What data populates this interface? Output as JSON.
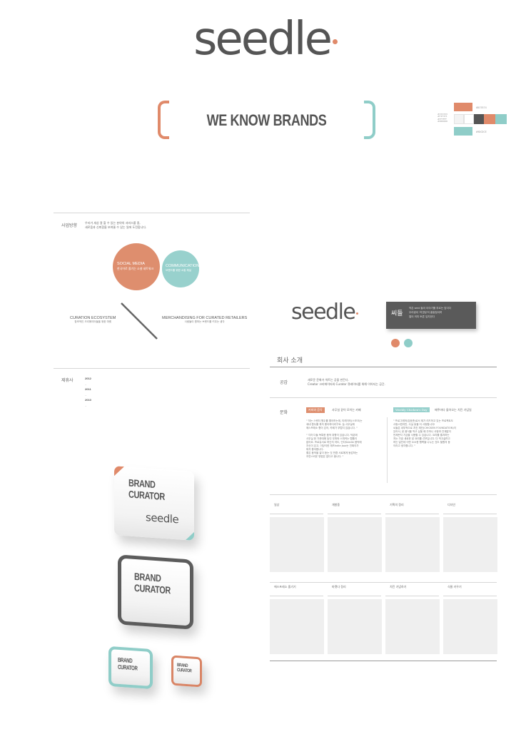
{
  "logo": {
    "text": "seedle"
  },
  "hero": {
    "tagline": "WE KNOW BRANDS"
  },
  "palette": {
    "colors": [
      "#e08a6a",
      "#f3f3f3",
      "#555555",
      "#8fcdc8"
    ],
    "hex_top": "#DC9374",
    "hex_left_1": "#333333",
    "hex_left_2": "#F3F3F3",
    "hex_left_3": "#FFFFFF",
    "hex_left_4": "#888888",
    "hex_bottom": "#9DCDCE"
  },
  "left_panel": {
    "direction_heading": "사업방향",
    "direction_text_1": "우리가 세상 잘 할 수 있는 분야의 서비스를 중,",
    "direction_text_2": "새로움과 신뢰함을 보여줄 수 있는 일에 도전합니다.",
    "social_title": "SOCIAL MEDIA",
    "social_sub": "한국어로 즐기는 소셜 네트워크",
    "comm_title": "COMMUNICATION",
    "comm_sub": "브랜드를 위한 소통 채널",
    "curation_title": "CURATION ECOSYSTEM",
    "curation_sub": "창조적인 크리에이터들을 위한 마켓",
    "merch_title": "MERCHANDISING FOR CURATED RETAILERS",
    "merch_sub": "사람들이 원하는 브랜드를 키우는 생각",
    "partners_heading": "제휴사",
    "years": [
      "2012",
      "2011",
      "2010"
    ]
  },
  "right_panel": {
    "logo": "seedle",
    "card_title": "씨들",
    "card_text_1": "작은 seed 들이 이야기를 부르는 앞이다",
    "card_text_2": "우리랑이 '커넷팅'의 출발점이며",
    "card_text_3": "열어 의미 토론 잎지한다",
    "section_title": "회사 소개",
    "empathy_label": "공감",
    "empathy_text_1": "새로운 문화가 싹트는 공을 만든다.",
    "empathy_text_2": "Creator 크리에이터와 Curator 큐레이터를 위해 이어지는 공간.",
    "culture_label": "문화",
    "culture_tag_1": "커피와 음악",
    "culture_tag_1_text": "사무실 같이 모이는 카페",
    "culture_tag_2": "Weekly Chicken's Day",
    "culture_tag_2_text": "매주마다 돌아오는 치킨 기념일",
    "culture_col1": [
      "\" 저는 스탠더 원두를 좋아하는데, 티레이터(스모크)는",
      "세내 원두를 특히 좋아하더라구요. 늘 사무실에",
      "에스프레소 향이 있어, 카페가 부럽지 않습니다. \"",
      "",
      "\" 각자 다들 독특한 음악 취향이 있습니다. 덕분에",
      "사무실 한 가운데에 놓인 우퍼와 스피커는 랩툽이",
      "없어요. 프로듀서로 하는지 저도, 인디Seedle 음악에",
      "자신이 있고, 이당이한 재즈Indie Jazz는 진짜이가",
      "특히 좋아합니다.",
      "좋은 음악을 같이 듣는 것 만큼 서로에게 동감하는",
      "자연스러운 방법은 없다고 봅니다. \""
    ],
    "culture_col2": [
      "\" 프로그래머(강호준)로서 제가 리드하고 있는 프로젝트도",
      "사랑스럽지만, 사실 닭을 더 사랑합니다!",
      "씨들은 내부적으로 치킨 재단(CHICKEN FOUNDATION)이",
      "있어서, 닭 음식을 먹고 싶을 때 주머니 사정과 관계없이",
      "언제든지 기금을 사용할 수 있습니다. 요리를 즐겨하는",
      "저는 가끔 새로운 닭 요리를 선보입니다. 다 먹고살려고",
      "하는 일인데 이런 소소한 행복을 나누는 것도 필원의 동",
      "이라고 생각합니다. \""
    ],
    "grid_row1": [
      "일상",
      "개발중",
      "기획의 정리",
      "디자인"
    ],
    "grid_row2": [
      "에스프레소 즐기기",
      "마켓다 정리",
      "치킨 기념하기",
      "식물 키우기"
    ]
  },
  "brand_boxes": {
    "box1_title": "BRAND CURATOR",
    "box1_logo": "seedle",
    "box2_title": "BRAND CURATOR",
    "box3_title": "BRAND CURATOR",
    "box4_title": "BRAND CURATOR"
  }
}
